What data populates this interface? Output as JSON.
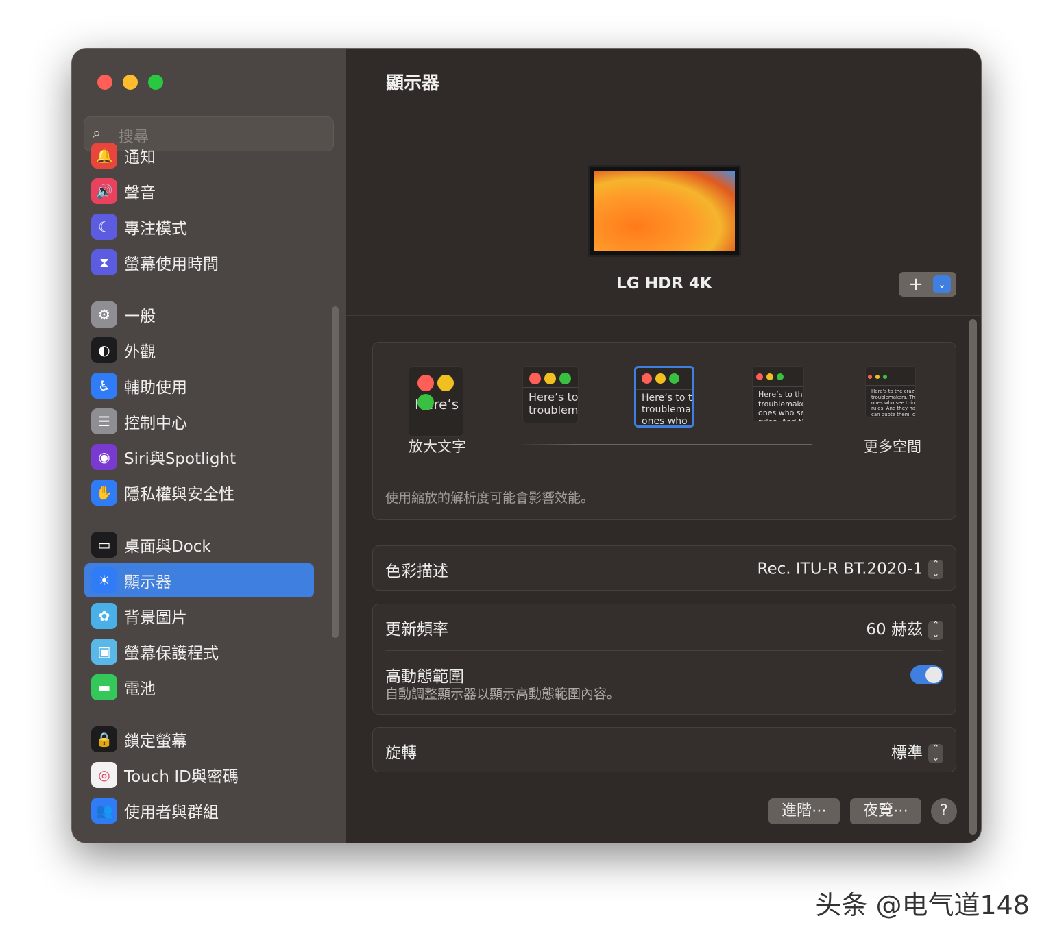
{
  "sidebar": {
    "search_placeholder": "搜尋",
    "items": [
      {
        "label": "通知",
        "icon": "bell-icon",
        "color": "#e8453c"
      },
      {
        "label": "聲音",
        "icon": "speaker-icon",
        "color": "#e9415e"
      },
      {
        "label": "專注模式",
        "icon": "moon-icon",
        "color": "#5c5ce0"
      },
      {
        "label": "螢幕使用時間",
        "icon": "hourglass-icon",
        "color": "#5c5ce0"
      },
      {
        "label": "一般",
        "icon": "gear-icon",
        "color": "#8e8e93"
      },
      {
        "label": "外觀",
        "icon": "appearance-icon",
        "color": "#1c1c1e"
      },
      {
        "label": "輔助使用",
        "icon": "accessibility-icon",
        "color": "#2f7cf6"
      },
      {
        "label": "控制中心",
        "icon": "toggles-icon",
        "color": "#8e8e93"
      },
      {
        "label": "Siri與Spotlight",
        "icon": "siri-icon",
        "color": "#7a3ad0"
      },
      {
        "label": "隱私權與安全性",
        "icon": "hand-icon",
        "color": "#2f7cf6"
      },
      {
        "label": "桌面與Dock",
        "icon": "dock-icon",
        "color": "#1c1c1e"
      },
      {
        "label": "顯示器",
        "icon": "sun-icon",
        "color": "#2f7cf6"
      },
      {
        "label": "背景圖片",
        "icon": "flower-icon",
        "color": "#4ab0e8"
      },
      {
        "label": "螢幕保護程式",
        "icon": "screensaver-icon",
        "color": "#5ab8e8"
      },
      {
        "label": "電池",
        "icon": "battery-icon",
        "color": "#34c759"
      },
      {
        "label": "鎖定螢幕",
        "icon": "lock-icon",
        "color": "#1c1c1e"
      },
      {
        "label": "Touch ID與密碼",
        "icon": "fingerprint-icon",
        "color": "#f2f2f2"
      },
      {
        "label": "使用者與群組",
        "icon": "users-icon",
        "color": "#2f7cf6"
      }
    ],
    "selected": "顯示器"
  },
  "main": {
    "title": "顯示器",
    "monitor_name": "LG HDR 4K",
    "add_label": "+",
    "resolution": {
      "previews": [
        "Here’s",
        "Here’s to\ntroublem",
        "Here’s to t\ntroublema\nones who",
        "Here’s to the cr\ntroublemakers.\nones who see t\nrules. And they",
        "Here’s to the crazy one\ntroublemakers. The rou\nones who see things dif\nrules. And they have no\ncan quote them, disagr\nthem. About the only th\nBecause they change t"
      ],
      "selected_index": 2,
      "left_label": "放大文字",
      "right_label": "更多空間",
      "note": "使用縮放的解析度可能會影響效能。"
    },
    "color_profile": {
      "label": "色彩描述",
      "value": "Rec. ITU-R BT.2020-1"
    },
    "refresh_rate": {
      "label": "更新頻率",
      "value": "60 赫茲"
    },
    "hdr": {
      "label": "高動態範圍",
      "description": "自動調整顯示器以顯示高動態範圍內容。",
      "enabled": true
    },
    "rotation": {
      "label": "旋轉",
      "value": "標準"
    },
    "advanced_label": "進階⋯",
    "night_shift_label": "夜覽⋯",
    "help_label": "?"
  },
  "watermark": "头条 @电气道148"
}
